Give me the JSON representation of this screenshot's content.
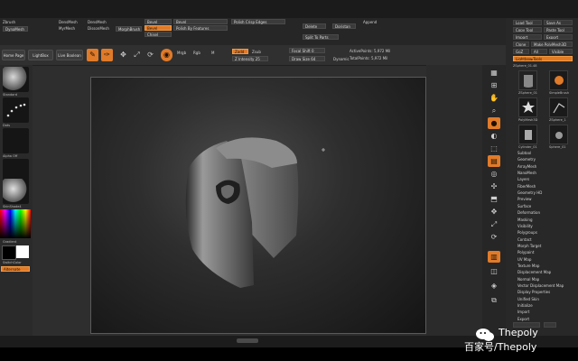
{
  "top_menu": {
    "col1": [
      "Zbrush",
      "DynaMesh"
    ],
    "col2": [
      "DensMesh",
      "MyrMesh"
    ],
    "col3": [
      "DensMesh",
      "DissonMesh"
    ],
    "col4": [
      "MorphBrush"
    ],
    "fields": [
      "Bevel",
      "Bevel",
      "Chisel"
    ],
    "fields2": [
      "Bevel",
      "Polish By Features"
    ],
    "field3": "Polish Crisp Edges",
    "right_btns": [
      "Delete",
      "Doristan"
    ],
    "split_label": "Split To Parts",
    "append": "Append"
  },
  "toolbar": {
    "home_page": "Home Page",
    "lightbox": "LightBox",
    "live_boolean": "Live Boolean",
    "icons": [
      "Edit",
      "Draw",
      "Move",
      "Scale",
      "Rotate",
      "Gizmo"
    ],
    "mrgb": "Mrgb",
    "rgb": "Rgb",
    "m": "M",
    "zadd": "Zadd",
    "zsub": "Zsub",
    "z_intensity": "Z Intensity 25",
    "focal_shift": "Focal Shift 0",
    "draw_size": "Draw Size 64",
    "dynamic": "Dynamic",
    "active_points": "ActivePoints: 5,972 Mil",
    "total_points": "TotalPoints: 5,972 Mil"
  },
  "left_panel": {
    "labels": [
      "Standard",
      "Dots",
      "Alpha Off",
      "Texture Off",
      "SkinShade4",
      "Gradient",
      "SwitchColor",
      "Alternate"
    ]
  },
  "tray": {
    "rows": [
      [
        "Load Tool",
        "Save As"
      ],
      [
        "Copy Tool",
        "Paste Tool"
      ],
      [
        "Import",
        "Export"
      ],
      [
        "Clone",
        "Make PolyMesh3D"
      ],
      [
        "GoZ",
        "All",
        "Visible"
      ],
      [
        "Lightbox▸Tools"
      ]
    ],
    "subtool_title": "ZSphere_01.48",
    "tools": [
      "ZSphere_01",
      "SimpleBrush",
      "PolyMesh3D",
      "ZSphere_1",
      "Cylinder_01",
      "Sphere_01"
    ],
    "menu": [
      "Subtool",
      "Geometry",
      "ArrayMesh",
      "NanoMesh",
      "Layers",
      "FiberMesh",
      "Geometry HD",
      "Preview",
      "Surface",
      "Deformation",
      "Masking",
      "Visibility",
      "Polygroups",
      "Contact",
      "Morph Target",
      "Polypaint",
      "UV Map",
      "Texture Map",
      "Displacement Map",
      "Normal Map",
      "Vector Displacement Map",
      "Display Properties",
      "Unified Skin",
      "Initialize",
      "Import",
      "Export"
    ]
  },
  "right_sidebar": {
    "icons": [
      "Bpr",
      "SPix",
      "Scroll",
      "Zoom",
      "Actual",
      "AAHalf",
      "Persp",
      "Floor",
      "Local",
      "Gxyz",
      "Frame",
      "Move",
      "Scale",
      "Rotate",
      "LineFill",
      "Transp",
      "Solo",
      "Xpose"
    ]
  },
  "watermark": {
    "text": "百家号/Thepoly",
    "brand": "Thepoly"
  },
  "colors": {
    "accent": "#e07b2a",
    "panel": "#2e2e2e",
    "viewport_light": "#4c4c4c"
  }
}
